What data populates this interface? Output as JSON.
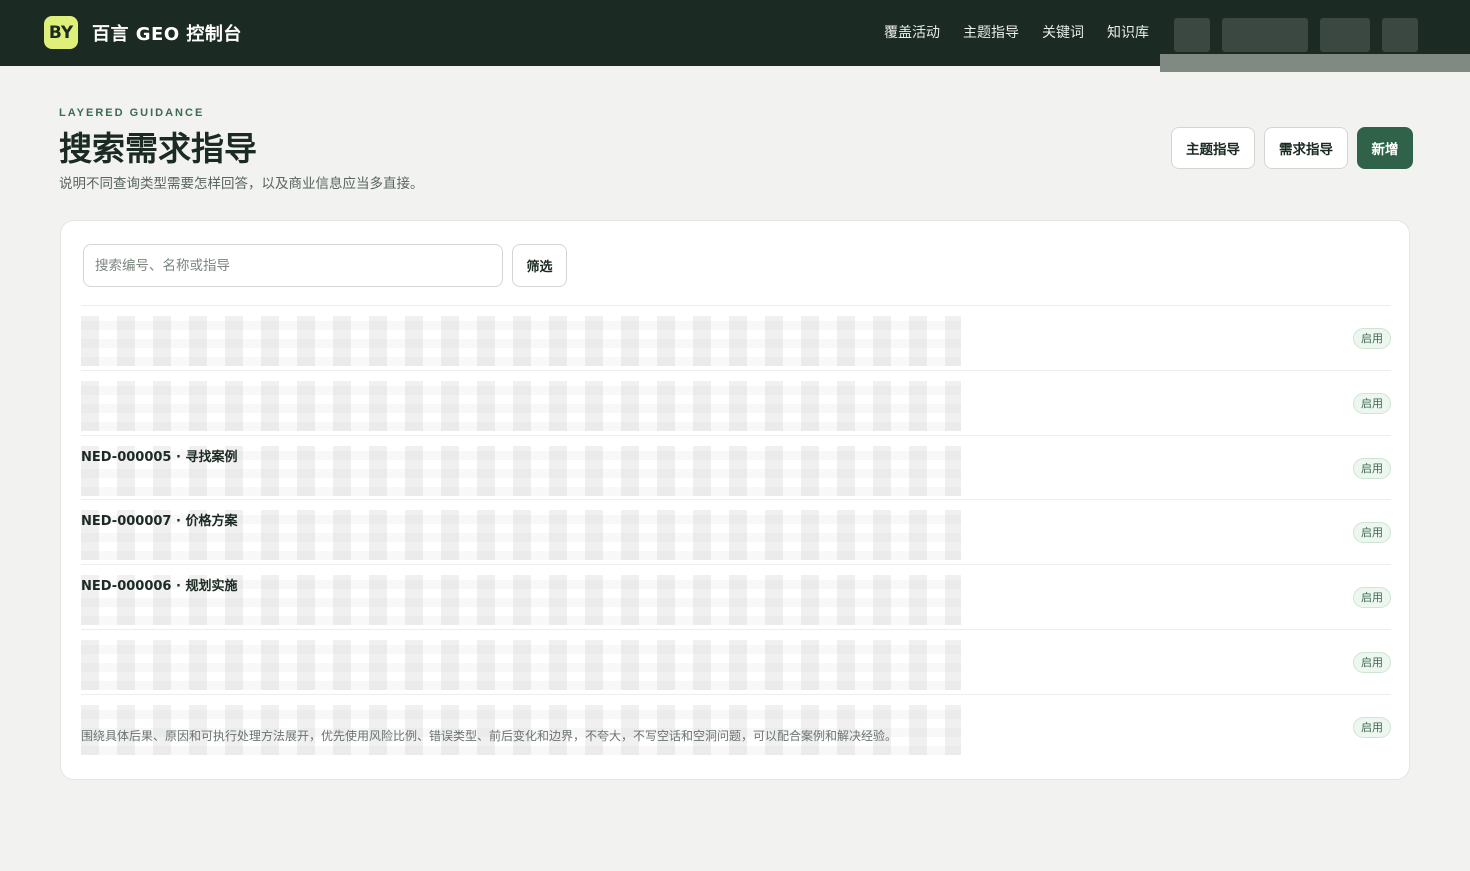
{
  "header": {
    "logo_text": "BY",
    "app_title": "百言 GEO 控制台",
    "nav": [
      "覆盖活动",
      "主题指导",
      "关键词",
      "知识库"
    ]
  },
  "page": {
    "eyebrow": "LAYERED GUIDANCE",
    "title": "搜索需求指导",
    "subtitle": "说明不同查询类型需要怎样回答，以及商业信息应当多直接。",
    "actions": {
      "topic_guidance": "主题指导",
      "need_guidance": "需求指导",
      "add": "新增"
    }
  },
  "filters": {
    "search_placeholder": "搜索编号、名称或指导",
    "search_value": "",
    "filter_label": "筛选"
  },
  "rows": [
    {
      "title": "",
      "description": "",
      "status": "启用"
    },
    {
      "title": "",
      "description": "",
      "status": "启用"
    },
    {
      "title": "NED-000005 · 寻找案例",
      "description": "",
      "status": "启用"
    },
    {
      "title": "NED-000007 · 价格方案",
      "description": "",
      "status": "启用"
    },
    {
      "title": "NED-000006 · 规划实施",
      "description": "",
      "status": "启用"
    },
    {
      "title": "",
      "description": "",
      "status": "启用"
    },
    {
      "title": "",
      "description": "围绕具体后果、原因和可执行处理方法展开，优先使用风险比例、错误类型、前后变化和边界，不夸大，不写空话和空洞问题，可以配合案例和解决经验。",
      "status": "启用"
    }
  ],
  "colors": {
    "topbar": "#1b2a22",
    "logo_badge": "#dff07a",
    "primary": "#2f6248",
    "background": "#f2f3f0",
    "status_badge": "#3d6a52"
  }
}
